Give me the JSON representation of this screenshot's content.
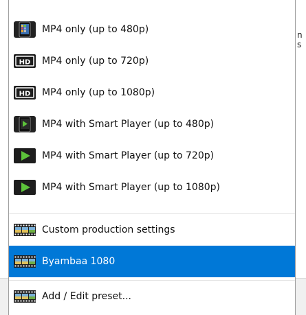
{
  "background": {
    "right_fragments": [
      "n",
      "s"
    ]
  },
  "menu": {
    "items": [
      {
        "label": "MP4 only (up to 480p)",
        "icon": "phone-icon"
      },
      {
        "label": "MP4 only (up to 720p)",
        "icon": "hd-icon"
      },
      {
        "label": "MP4 only (up to 1080p)",
        "icon": "hd-icon"
      },
      {
        "label": "MP4 with Smart Player (up to 480p)",
        "icon": "phone-play-icon"
      },
      {
        "label": "MP4 with Smart Player (up to 720p)",
        "icon": "play-icon"
      },
      {
        "label": "MP4 with Smart Player (up to 1080p)",
        "icon": "play-icon"
      },
      {
        "label": "Custom production settings",
        "icon": "film-icon"
      },
      {
        "label": "Byambaa 1080",
        "icon": "film-icon",
        "selected": true
      },
      {
        "label": "Add / Edit preset...",
        "icon": "film-icon"
      }
    ],
    "selected_color": "#0078d7"
  }
}
